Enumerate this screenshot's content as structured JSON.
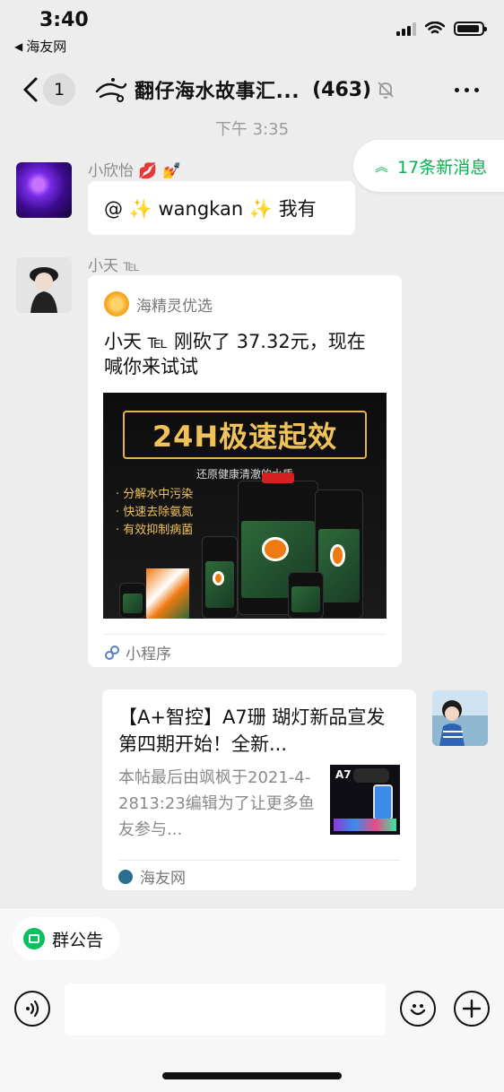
{
  "status_bar": {
    "time": "3:40",
    "back_app": "海友网"
  },
  "nav": {
    "unread_count": "1",
    "title": "翻仔海水故事汇...",
    "member_count": "(463)"
  },
  "chat": {
    "timestamp": "下午 3:35",
    "new_messages": "17条新消息",
    "messages": [
      {
        "sender": "小欣怡 💋 💅",
        "text": "@ ✨ wangkan ✨ 我有"
      },
      {
        "sender": "小天 ℡",
        "mini_program": {
          "app_name": "海精灵优选",
          "title": "小天 ℡ 刚砍了 37.32元，现在喊你来试试",
          "promo_headline": "24H极速起效",
          "promo_sub": "还原健康清澈的水质",
          "promo_bullets": [
            "· 分解水中污染",
            "· 快速去除氨氮",
            "· 有效抑制病菌"
          ],
          "footer": "小程序"
        }
      },
      {
        "sender": "",
        "link_card": {
          "title": "【A+智控】A7珊 瑚灯新品宣发 第四期开始！全新...",
          "description": "本帖最后由飒枫于2021-4-2813:23编辑为了让更多鱼友参与...",
          "thumb_text": "A7",
          "source": "海友网"
        }
      }
    ]
  },
  "bottom": {
    "announcement": "群公告",
    "input_placeholder": ""
  },
  "colors": {
    "accent_green": "#07c160",
    "background": "#ededed"
  }
}
